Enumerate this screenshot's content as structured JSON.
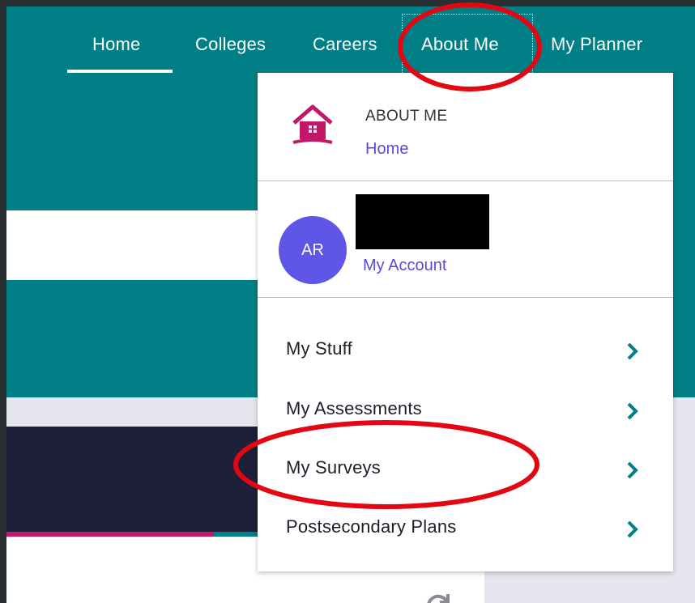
{
  "nav": {
    "items": [
      {
        "label": "Home"
      },
      {
        "label": "Colleges"
      },
      {
        "label": "Careers"
      },
      {
        "label": "About Me"
      },
      {
        "label": "My Planner"
      }
    ]
  },
  "dropdown": {
    "title": "ABOUT ME",
    "home_link": "Home",
    "user": {
      "initials": "AR",
      "account_link": "My Account"
    },
    "items": [
      {
        "label": "My Stuff"
      },
      {
        "label": "My Assessments"
      },
      {
        "label": "My Surveys"
      },
      {
        "label": "Postsecondary Plans"
      }
    ]
  },
  "icons": {
    "house": "house-icon",
    "chevron": "chevron-right-icon",
    "refresh": "refresh-icon"
  },
  "colors": {
    "teal": "#007f86",
    "pink": "#c2186a",
    "link_purple": "#5a4bd6",
    "avatar_purple": "#5f55e6",
    "annotation_red": "#e30613"
  }
}
